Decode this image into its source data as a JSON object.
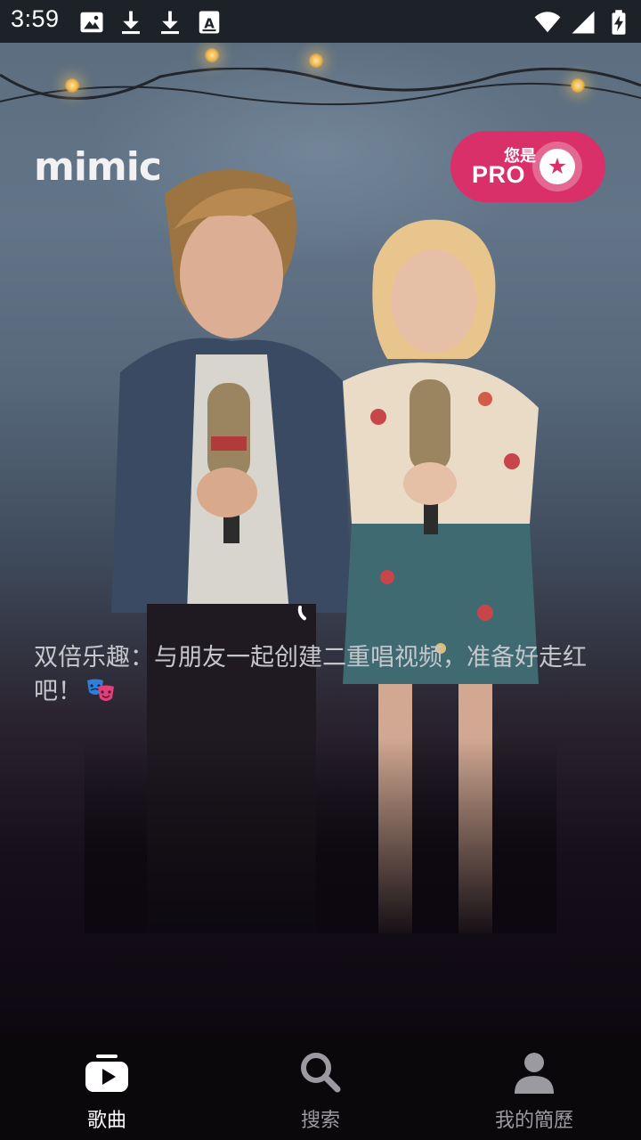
{
  "status_bar": {
    "time": "3:59",
    "left_icons": [
      "image-icon",
      "download-icon",
      "download-icon",
      "font-icon"
    ],
    "right_icons": [
      "wifi-icon",
      "signal-icon",
      "battery-icon"
    ]
  },
  "header": {
    "logo": "mimic",
    "pro_badge": {
      "top_label": "您是",
      "main_label": "PRO",
      "icon": "star-icon",
      "color": "#d9306a"
    }
  },
  "hero": {
    "caption": "双倍乐趣：与朋友一起创建二重唱视频，准备好走红吧！",
    "caption_emoji": "performing-arts-icon",
    "loading": true
  },
  "bottom_nav": {
    "items": [
      {
        "label": "歌曲",
        "icon": "play-icon",
        "active": true
      },
      {
        "label": "搜索",
        "icon": "search-icon",
        "active": false
      },
      {
        "label": "我的簡歷",
        "icon": "person-icon",
        "active": false
      }
    ]
  },
  "colors": {
    "status_bar_bg": "#1d2228",
    "accent": "#d9306a",
    "nav_bg": "#0b080c",
    "nav_active": "#ffffff",
    "nav_inactive": "#9a9aa0"
  }
}
